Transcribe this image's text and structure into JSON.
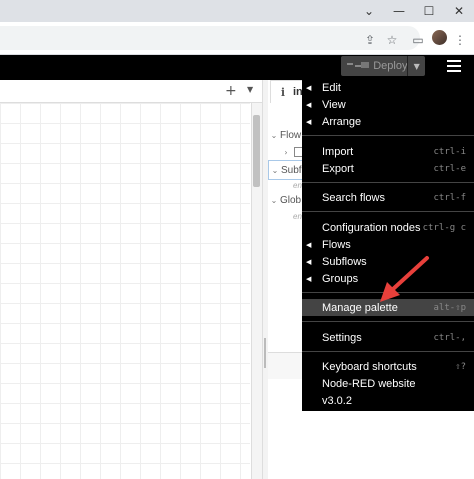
{
  "browser": {
    "window_controls": {
      "chevron": "⌄",
      "minimize": "—",
      "maximize": "☐",
      "close": "✕"
    },
    "toolbar_icons": [
      "share-icon",
      "star-icon",
      "tab-icon",
      "avatar",
      "kebab-menu-icon"
    ],
    "toolbar_glyphs": {
      "share": "⇪",
      "star": "☆",
      "tab": "▭",
      "kebab": "⋮"
    }
  },
  "header": {
    "deploy_label": "Deploy",
    "deploy_caret": "▼"
  },
  "workspace": {
    "add_tab": "+",
    "tab_menu": "▼"
  },
  "sidebar": {
    "tab_icon": "i",
    "tab_label": "inf",
    "rows": [
      {
        "twisty": "⌄",
        "label": "Flow"
      },
      {
        "twisty": "›",
        "label": ""
      },
      {
        "twisty": "⌄",
        "label": "Subf"
      },
      {
        "twisty": "",
        "label": ""
      },
      {
        "twisty": "⌄",
        "label": "Glob"
      },
      {
        "twisty": "",
        "label": ""
      }
    ],
    "empty_1": "en",
    "empty_2": "en"
  },
  "menu": {
    "items": [
      {
        "label": "Edit",
        "arrow": "◀",
        "key": ""
      },
      {
        "label": "View",
        "arrow": "◀",
        "key": ""
      },
      {
        "label": "Arrange",
        "arrow": "◀",
        "key": ""
      },
      {
        "label": "Import",
        "arrow": "",
        "key": "ctrl-i"
      },
      {
        "label": "Export",
        "arrow": "",
        "key": "ctrl-e"
      },
      {
        "label": "Search flows",
        "arrow": "",
        "key": "ctrl-f"
      },
      {
        "label": "Configuration nodes",
        "arrow": "",
        "key": "ctrl-g c"
      },
      {
        "label": "Flows",
        "arrow": "◀",
        "key": ""
      },
      {
        "label": "Subflows",
        "arrow": "◀",
        "key": ""
      },
      {
        "label": "Groups",
        "arrow": "◀",
        "key": ""
      },
      {
        "label": "Manage palette",
        "arrow": "",
        "key": "alt-⇧p"
      },
      {
        "label": "Settings",
        "arrow": "",
        "key": "ctrl-,"
      },
      {
        "label": "Keyboard shortcuts",
        "arrow": "",
        "key": "⇧?"
      },
      {
        "label": "Node-RED website",
        "arrow": "",
        "key": ""
      },
      {
        "label": "v3.0.2",
        "arrow": "",
        "key": ""
      }
    ]
  },
  "colors": {
    "header": "#000000",
    "menu_bg": "#000000",
    "menu_highlight": "#444444",
    "annotation_arrow": "#e8403b"
  }
}
